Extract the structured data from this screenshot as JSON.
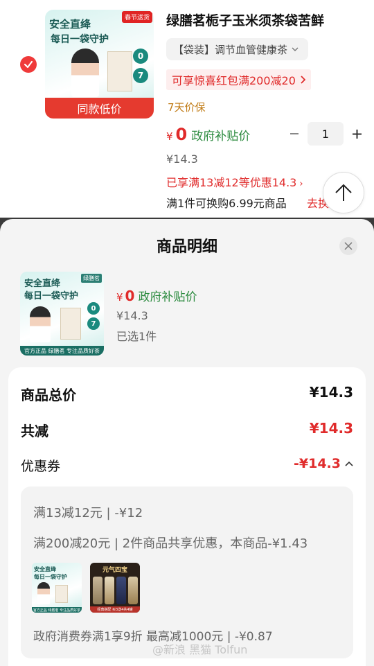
{
  "cart_item": {
    "title": "绿膳茗栀子玉米须茶袋苦鲜",
    "image": {
      "line1": "安全直绛",
      "line2": "每日一袋守护",
      "tag": "春节送货",
      "badge_top": "0",
      "badge_bottom": "7",
      "ribbon": "同款低价"
    },
    "spec": "【袋装】调节血管健康茶",
    "coupon": "可享惊喜红包满200减20",
    "guarantee": "7天价保",
    "currency": "¥",
    "price": "0",
    "gov_label": "政府补贴价",
    "original_price": "¥14.3",
    "quantity": "1",
    "promo": "已享满13减12等优惠14.3",
    "swap_text": "满1件可换购6.99元商品",
    "swap_link": "去换购"
  },
  "sheet": {
    "title": "商品明细",
    "product": {
      "image_line1": "安全直绛",
      "image_line2": "每日一袋守护",
      "image_brand": "绿膳茗",
      "image_badge_top": "0",
      "image_badge_bottom": "7",
      "image_footer": "官方正品 绿膳茗 专注品质好茶",
      "currency": "¥",
      "price": "0",
      "gov_label": "政府补贴价",
      "original_price": "¥14.3",
      "selected": "已选1件"
    },
    "summary": {
      "total_label": "商品总价",
      "total_value": "¥14.3",
      "reduce_label": "共减",
      "reduce_value": "¥14.3",
      "coupon_label": "优惠券",
      "coupon_value": "-¥14.3"
    },
    "coupon_details": {
      "line1": "满13减12元 | -¥12",
      "line2": "满200减20元 | 2件商品共享优惠，本商品-¥1.43",
      "thumb1_line1": "安全直绛",
      "thumb1_line2": "每日一袋守护",
      "thumb1_footer": "官方正品 绿膳茗 专注品质好茶",
      "thumb2_title": "元气四宝",
      "thumb2_footer": "经典搭配 买3送4共4罐",
      "line3": "政府消费券满1享9折 最高减1000元 | -¥0.87",
      "watermark": "@新浪 黑猫 Tolfun"
    }
  },
  "colors": {
    "accent_red": "#e02b2b",
    "gov_green": "#2b8a3e",
    "guarantee_orange": "#c07a14"
  },
  "icons": {
    "check": "check-circle-icon",
    "spec_arrow": "chevron-down-icon",
    "coupon_arrow": "chevron-right-icon",
    "to_top": "arrow-up-icon",
    "close": "close-icon",
    "collapse": "chevron-up-icon"
  }
}
